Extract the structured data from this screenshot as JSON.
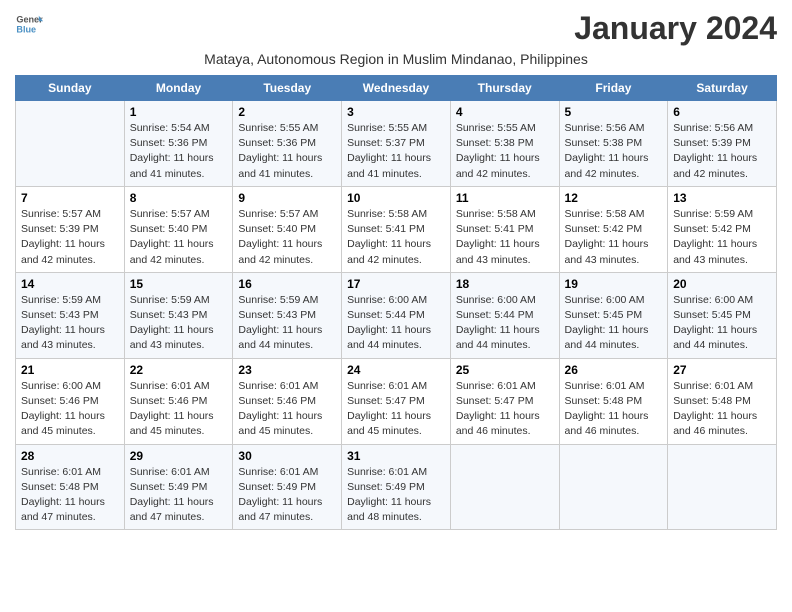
{
  "logo": {
    "line1": "General",
    "line2": "Blue"
  },
  "title": "January 2024",
  "subtitle": "Mataya, Autonomous Region in Muslim Mindanao, Philippines",
  "days_of_week": [
    "Sunday",
    "Monday",
    "Tuesday",
    "Wednesday",
    "Thursday",
    "Friday",
    "Saturday"
  ],
  "weeks": [
    [
      {
        "day": "",
        "info": ""
      },
      {
        "day": "1",
        "info": "Sunrise: 5:54 AM\nSunset: 5:36 PM\nDaylight: 11 hours\nand 41 minutes."
      },
      {
        "day": "2",
        "info": "Sunrise: 5:55 AM\nSunset: 5:36 PM\nDaylight: 11 hours\nand 41 minutes."
      },
      {
        "day": "3",
        "info": "Sunrise: 5:55 AM\nSunset: 5:37 PM\nDaylight: 11 hours\nand 41 minutes."
      },
      {
        "day": "4",
        "info": "Sunrise: 5:55 AM\nSunset: 5:38 PM\nDaylight: 11 hours\nand 42 minutes."
      },
      {
        "day": "5",
        "info": "Sunrise: 5:56 AM\nSunset: 5:38 PM\nDaylight: 11 hours\nand 42 minutes."
      },
      {
        "day": "6",
        "info": "Sunrise: 5:56 AM\nSunset: 5:39 PM\nDaylight: 11 hours\nand 42 minutes."
      }
    ],
    [
      {
        "day": "7",
        "info": "Sunrise: 5:57 AM\nSunset: 5:39 PM\nDaylight: 11 hours\nand 42 minutes."
      },
      {
        "day": "8",
        "info": "Sunrise: 5:57 AM\nSunset: 5:40 PM\nDaylight: 11 hours\nand 42 minutes."
      },
      {
        "day": "9",
        "info": "Sunrise: 5:57 AM\nSunset: 5:40 PM\nDaylight: 11 hours\nand 42 minutes."
      },
      {
        "day": "10",
        "info": "Sunrise: 5:58 AM\nSunset: 5:41 PM\nDaylight: 11 hours\nand 42 minutes."
      },
      {
        "day": "11",
        "info": "Sunrise: 5:58 AM\nSunset: 5:41 PM\nDaylight: 11 hours\nand 43 minutes."
      },
      {
        "day": "12",
        "info": "Sunrise: 5:58 AM\nSunset: 5:42 PM\nDaylight: 11 hours\nand 43 minutes."
      },
      {
        "day": "13",
        "info": "Sunrise: 5:59 AM\nSunset: 5:42 PM\nDaylight: 11 hours\nand 43 minutes."
      }
    ],
    [
      {
        "day": "14",
        "info": "Sunrise: 5:59 AM\nSunset: 5:43 PM\nDaylight: 11 hours\nand 43 minutes."
      },
      {
        "day": "15",
        "info": "Sunrise: 5:59 AM\nSunset: 5:43 PM\nDaylight: 11 hours\nand 43 minutes."
      },
      {
        "day": "16",
        "info": "Sunrise: 5:59 AM\nSunset: 5:43 PM\nDaylight: 11 hours\nand 44 minutes."
      },
      {
        "day": "17",
        "info": "Sunrise: 6:00 AM\nSunset: 5:44 PM\nDaylight: 11 hours\nand 44 minutes."
      },
      {
        "day": "18",
        "info": "Sunrise: 6:00 AM\nSunset: 5:44 PM\nDaylight: 11 hours\nand 44 minutes."
      },
      {
        "day": "19",
        "info": "Sunrise: 6:00 AM\nSunset: 5:45 PM\nDaylight: 11 hours\nand 44 minutes."
      },
      {
        "day": "20",
        "info": "Sunrise: 6:00 AM\nSunset: 5:45 PM\nDaylight: 11 hours\nand 44 minutes."
      }
    ],
    [
      {
        "day": "21",
        "info": "Sunrise: 6:00 AM\nSunset: 5:46 PM\nDaylight: 11 hours\nand 45 minutes."
      },
      {
        "day": "22",
        "info": "Sunrise: 6:01 AM\nSunset: 5:46 PM\nDaylight: 11 hours\nand 45 minutes."
      },
      {
        "day": "23",
        "info": "Sunrise: 6:01 AM\nSunset: 5:46 PM\nDaylight: 11 hours\nand 45 minutes."
      },
      {
        "day": "24",
        "info": "Sunrise: 6:01 AM\nSunset: 5:47 PM\nDaylight: 11 hours\nand 45 minutes."
      },
      {
        "day": "25",
        "info": "Sunrise: 6:01 AM\nSunset: 5:47 PM\nDaylight: 11 hours\nand 46 minutes."
      },
      {
        "day": "26",
        "info": "Sunrise: 6:01 AM\nSunset: 5:48 PM\nDaylight: 11 hours\nand 46 minutes."
      },
      {
        "day": "27",
        "info": "Sunrise: 6:01 AM\nSunset: 5:48 PM\nDaylight: 11 hours\nand 46 minutes."
      }
    ],
    [
      {
        "day": "28",
        "info": "Sunrise: 6:01 AM\nSunset: 5:48 PM\nDaylight: 11 hours\nand 47 minutes."
      },
      {
        "day": "29",
        "info": "Sunrise: 6:01 AM\nSunset: 5:49 PM\nDaylight: 11 hours\nand 47 minutes."
      },
      {
        "day": "30",
        "info": "Sunrise: 6:01 AM\nSunset: 5:49 PM\nDaylight: 11 hours\nand 47 minutes."
      },
      {
        "day": "31",
        "info": "Sunrise: 6:01 AM\nSunset: 5:49 PM\nDaylight: 11 hours\nand 48 minutes."
      },
      {
        "day": "",
        "info": ""
      },
      {
        "day": "",
        "info": ""
      },
      {
        "day": "",
        "info": ""
      }
    ]
  ]
}
